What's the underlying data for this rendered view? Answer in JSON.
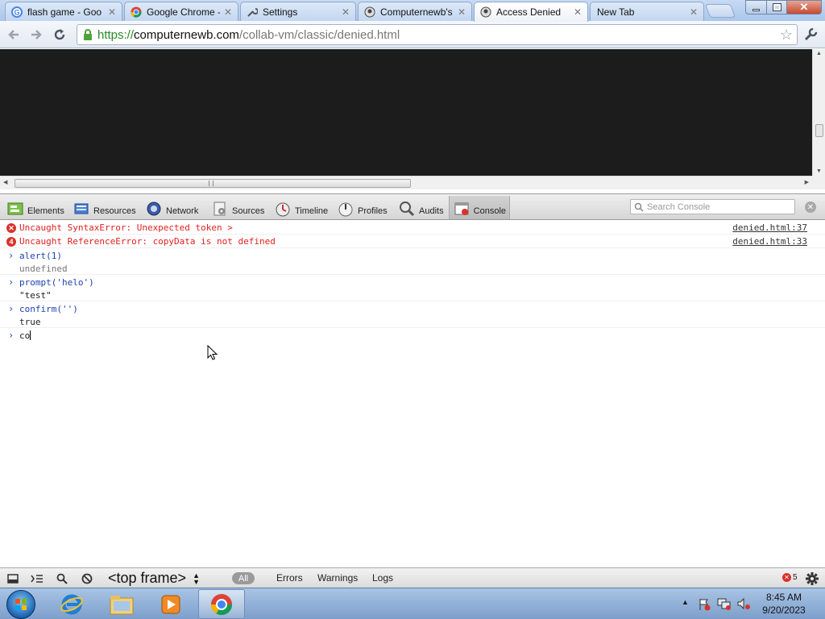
{
  "tabs": [
    {
      "title": "flash game - Goo",
      "favicon": "google-icon"
    },
    {
      "title": "Google Chrome -",
      "favicon": "chrome-icon"
    },
    {
      "title": "Settings",
      "favicon": "wrench-icon"
    },
    {
      "title": "Computernewb's",
      "favicon": "page-icon"
    },
    {
      "title": "Access Denied",
      "favicon": "page-icon",
      "active": true
    },
    {
      "title": "New Tab",
      "favicon": "none"
    }
  ],
  "omnibox": {
    "url_scheme": "https://",
    "url_host": "computernewb.com",
    "url_path": "/collab-vm/classic/denied.html"
  },
  "devtools": {
    "tabs": [
      "Elements",
      "Resources",
      "Network",
      "Sources",
      "Timeline",
      "Profiles",
      "Audits",
      "Console"
    ],
    "active_tab": "Console",
    "search_placeholder": "Search Console"
  },
  "console": {
    "errors": [
      {
        "message": "Uncaught SyntaxError: Unexpected token >",
        "source": "denied.html:37",
        "badge": ""
      },
      {
        "message": "Uncaught ReferenceError: copyData is not defined",
        "source": "denied.html:33",
        "badge": "4"
      }
    ],
    "entries": [
      {
        "command": "alert(1)",
        "result": "undefined"
      },
      {
        "command": "prompt('helo')",
        "result": "\"test\""
      },
      {
        "command": "confirm('')",
        "result": "true"
      }
    ],
    "current_input": "co"
  },
  "statusbar": {
    "frame": "<top frame>",
    "filter_all": "All",
    "filters": [
      "Errors",
      "Warnings",
      "Logs"
    ],
    "error_count": "5"
  },
  "taskbar": {
    "clock_time": "8:45 AM",
    "clock_date": "9/20/2023"
  },
  "colors": {
    "error_red": "#e02020",
    "command_blue": "#1f3fb0",
    "page_bg": "#1c1c1c"
  }
}
